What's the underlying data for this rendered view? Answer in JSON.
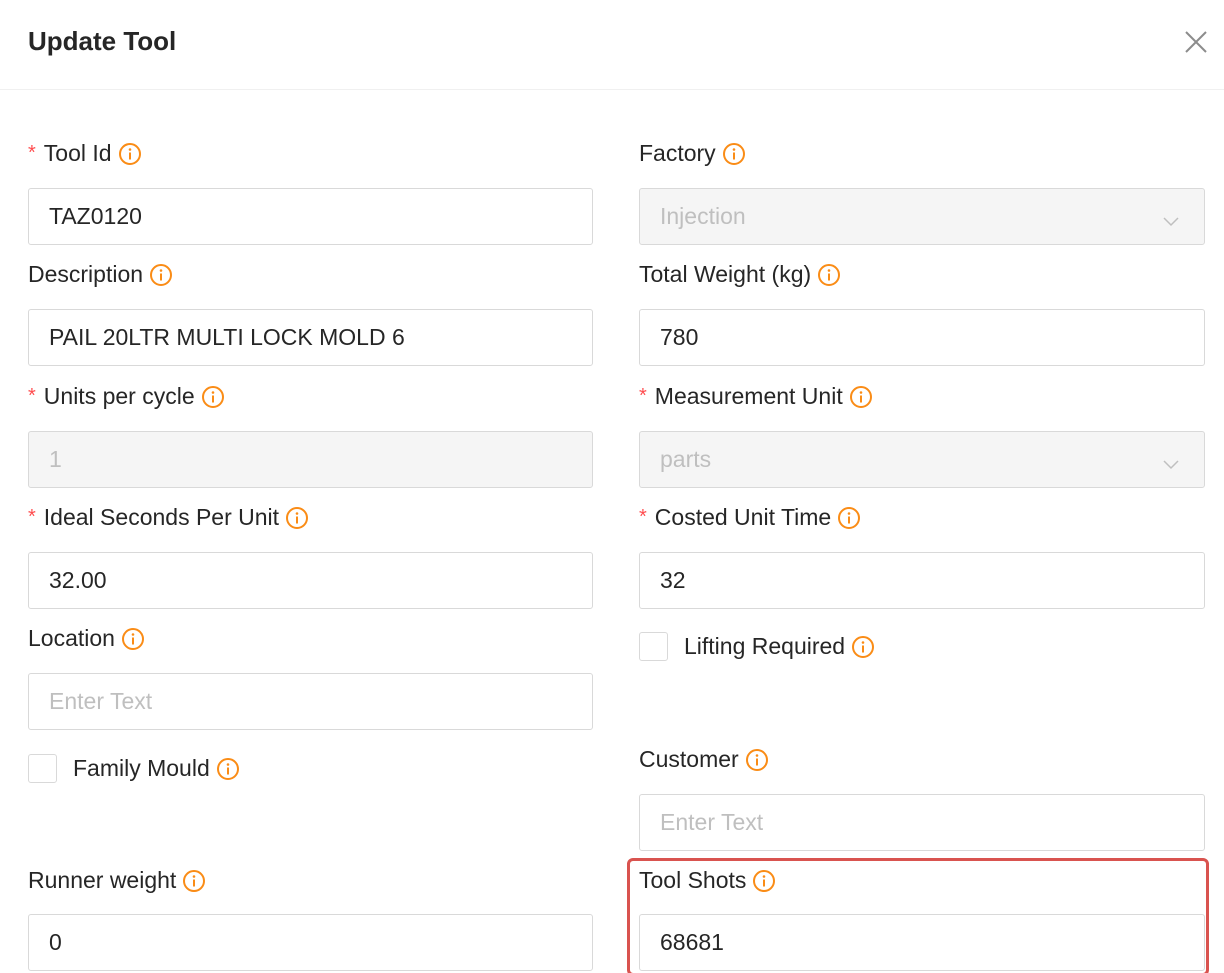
{
  "dialog": {
    "title": "Update Tool"
  },
  "fields": {
    "tool_id": {
      "label": "Tool Id",
      "required": true,
      "value": "TAZ0120"
    },
    "factory": {
      "label": "Factory",
      "required": false,
      "value": "Injection",
      "disabled": true
    },
    "description": {
      "label": "Description",
      "required": false,
      "value": "PAIL 20LTR MULTI LOCK MOLD 6"
    },
    "total_weight": {
      "label": "Total Weight (kg)",
      "required": false,
      "value": "780"
    },
    "units_per_cycle": {
      "label": "Units per cycle",
      "required": true,
      "value": "1",
      "disabled": true
    },
    "measurement_unit": {
      "label": "Measurement Unit",
      "required": true,
      "value": "parts",
      "disabled": true
    },
    "ideal_seconds": {
      "label": "Ideal Seconds Per Unit",
      "required": true,
      "value": "32.00"
    },
    "costed_unit_time": {
      "label": "Costed Unit Time",
      "required": true,
      "value": "32"
    },
    "location": {
      "label": "Location",
      "required": false,
      "value": "",
      "placeholder": "Enter Text"
    },
    "lifting_required": {
      "label": "Lifting Required",
      "checked": false
    },
    "family_mould": {
      "label": "Family Mould",
      "checked": false
    },
    "customer": {
      "label": "Customer",
      "required": false,
      "value": "",
      "placeholder": "Enter Text"
    },
    "runner_weight": {
      "label": "Runner weight",
      "required": false,
      "value": "0"
    },
    "tool_shots": {
      "label": "Tool Shots",
      "required": false,
      "value": "68681",
      "highlighted": true
    }
  },
  "required_marker": "*",
  "colors": {
    "required": "#ff4d4f",
    "info_icon": "#fa8c16",
    "highlight": "#d9534f",
    "disabled_bg": "#f5f5f5"
  },
  "icons": {
    "info": "info-circle-icon",
    "close": "close-icon",
    "select": "chevron-down-icon"
  }
}
